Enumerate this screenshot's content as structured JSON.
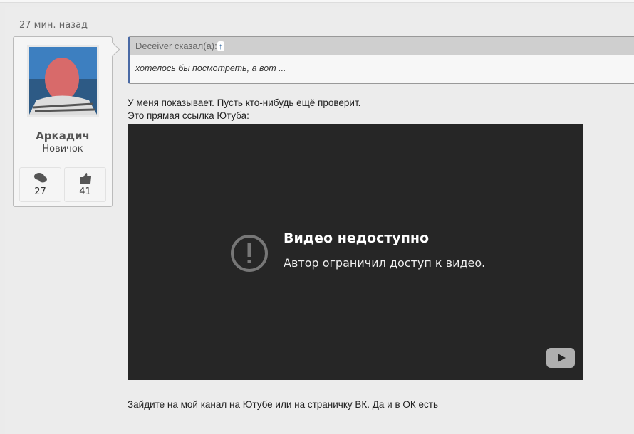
{
  "post": {
    "timestamp": "27 мин. назад",
    "author": {
      "name": "Аркадич",
      "role": "Новичок",
      "messages": "27",
      "likes": "41"
    },
    "quote": {
      "author_label": "Deceiver сказал(а):",
      "jump": "↑",
      "text": "хотелось бы посмотреть, а вот ..."
    },
    "line1": "У меня показывает. Пусть кто-нибудь ещё проверит.",
    "line2": "Это прямая ссылка Ютуба:",
    "video": {
      "title": "Видео недоступно",
      "subtitle": "Автор ограничил доступ к видео."
    },
    "footer": "Зайдите на мой канал на Ютубе или на страничку ВК. Да и в ОК есть"
  }
}
